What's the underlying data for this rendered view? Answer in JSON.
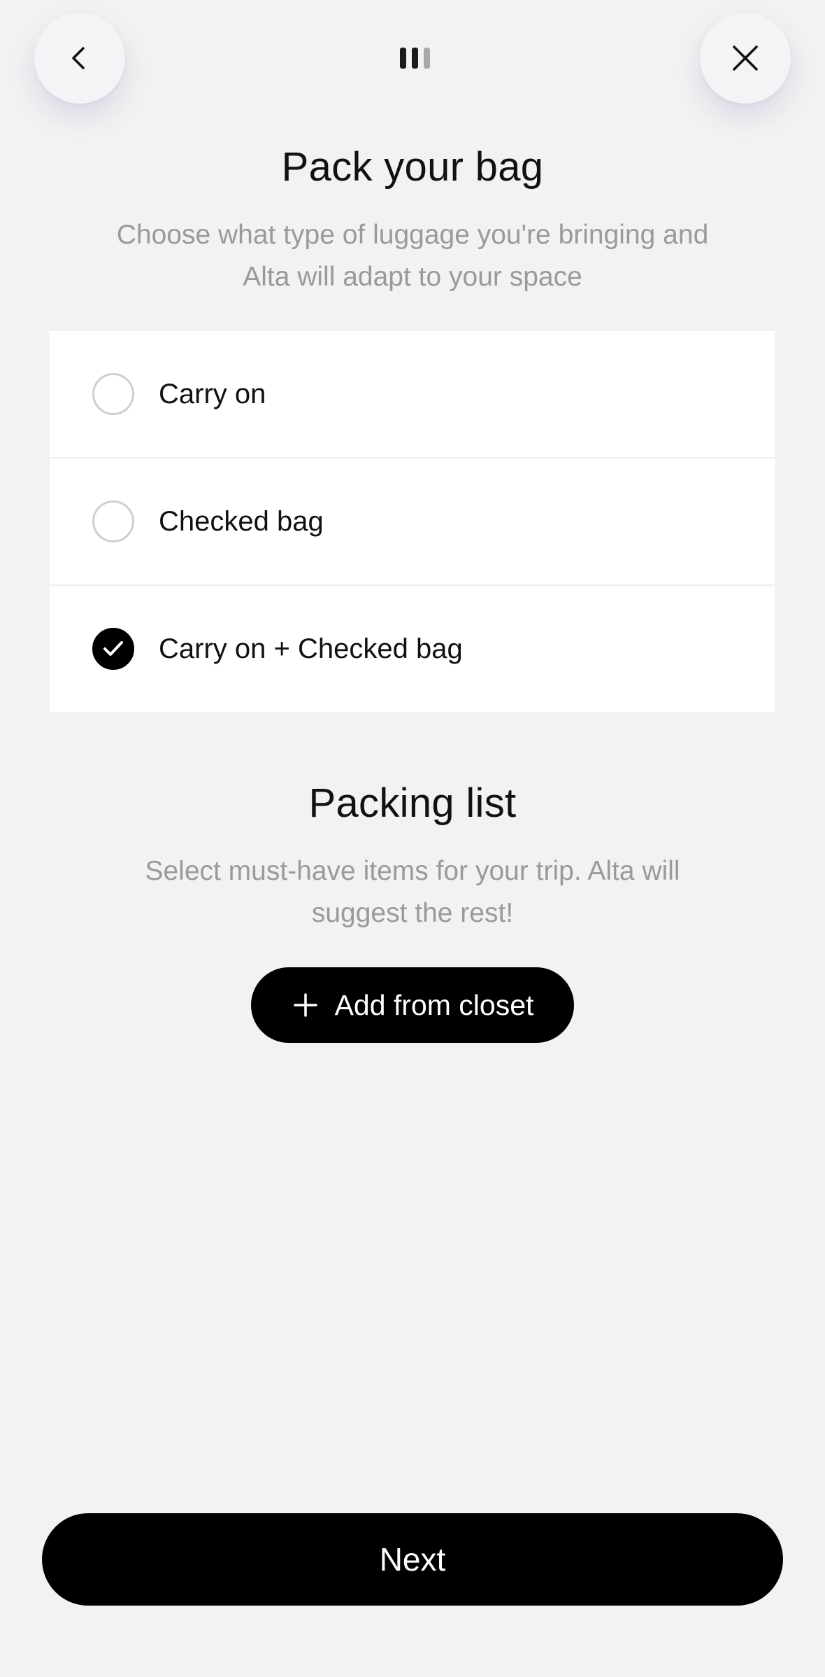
{
  "header": {
    "back_icon": "chevron-left-icon",
    "close_icon": "close-icon",
    "progress": {
      "total_steps": 3,
      "current_step": 2
    }
  },
  "luggage": {
    "title": "Pack your bag",
    "subtitle": "Choose what type of luggage you're bringing and Alta will adapt to your space",
    "options": [
      {
        "label": "Carry on",
        "selected": false
      },
      {
        "label": "Checked bag",
        "selected": false
      },
      {
        "label": "Carry on + Checked bag",
        "selected": true
      }
    ]
  },
  "packing_list": {
    "title": "Packing list",
    "subtitle": "Select must-have items for your trip. Alta will suggest the rest!",
    "add_button_label": "Add from closet",
    "add_button_icon": "plus-icon"
  },
  "footer": {
    "next_label": "Next"
  },
  "colors": {
    "background": "#f2f2f2",
    "primary": "#000000",
    "muted_text": "#9a9a9a",
    "card": "#ffffff"
  }
}
